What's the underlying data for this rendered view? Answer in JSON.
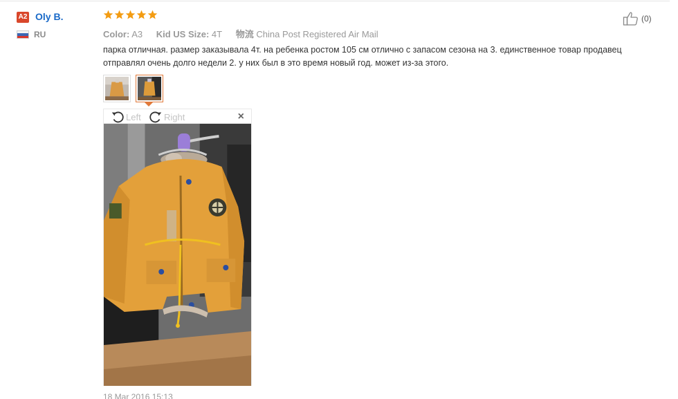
{
  "review": {
    "level_badge": "A2",
    "username": "Oly B.",
    "country": "RU",
    "rating_stars": 5,
    "star_color": "#f39c12",
    "meta": {
      "color_label": "Color:",
      "color_value": "A3",
      "size_label": "Kid US Size:",
      "size_value": "4T",
      "shipping_label": "物流",
      "shipping_value": "China Post Registered Air Mail"
    },
    "text": "парка отличная. размер заказывала 4т. на ребенка ростом 105 см отлично с запасом сезона на 3. единственное товар продавец отправлял очень долго недели 2. у них был в это время новый год. может из-за этого.",
    "helpful_count": "(0)",
    "viewer": {
      "rotate_left_label": "Left",
      "rotate_right_label": "Right",
      "close_symbol": "×"
    },
    "date": "18 Mar 2016 15:13"
  },
  "colors": {
    "accent_orange": "#e0793a",
    "link_blue": "#1a6ac8",
    "badge_red": "#d9472b",
    "jacket_mustard": "#e3a03a"
  },
  "icons": {
    "helpful": "thumbs-up-icon",
    "rotate_left": "rotate-left-icon",
    "rotate_right": "rotate-right-icon",
    "close": "close-icon",
    "shipping": "truck-icon"
  }
}
